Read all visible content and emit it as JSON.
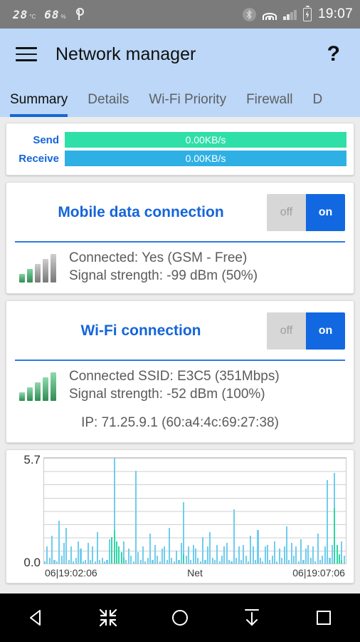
{
  "status_bar": {
    "temperature": "28",
    "temperature_unit": "°C",
    "humidity": "68",
    "humidity_unit": "%",
    "usb_icon": "usb-icon",
    "bluetooth_icon": "bluetooth-icon",
    "bluetooth_glyph": "B",
    "wifi_icon": "wifi-icon",
    "cell_signal_icon": "cell-signal-icon",
    "battery_icon": "battery-charging-icon",
    "battery_glyph": "⚡",
    "time": "19:07"
  },
  "app_bar": {
    "menu_icon": "hamburger-menu-icon",
    "title": "Network manager",
    "help_icon": "?",
    "tabs": [
      {
        "label": "Summary",
        "active": true
      },
      {
        "label": "Details",
        "active": false
      },
      {
        "label": "Wi-Fi Priority",
        "active": false
      },
      {
        "label": "Firewall",
        "active": false
      },
      {
        "label": "D",
        "active": false
      }
    ]
  },
  "speed_card": {
    "send_label": "Send",
    "send_value": "0.00KB/s",
    "send_color": "#2fdfa8",
    "receive_label": "Receive",
    "receive_value": "0.00KB/s",
    "receive_color": "#2fb0e4"
  },
  "mobile_card": {
    "title": "Mobile data connection",
    "toggle_off_label": "off",
    "toggle_on_label": "on",
    "toggle_state": "on",
    "signal_icon": "cell-signal-bars-icon",
    "signal_bars_filled": 2,
    "signal_bars_total": 5,
    "line1": "Connected: Yes (GSM - Free)",
    "line2": "Signal strength: -99 dBm (50%)"
  },
  "wifi_card": {
    "title": "Wi-Fi connection",
    "toggle_off_label": "off",
    "toggle_on_label": "on",
    "toggle_state": "on",
    "signal_icon": "wifi-signal-bars-icon",
    "signal_bars_filled": 5,
    "signal_bars_total": 5,
    "line1": "Connected SSID: E3C5 (351Mbps)",
    "line2": "Signal strength: -52 dBm (100%)",
    "ip_line": "IP: 71.25.9.1 (60:a4:4c:69:27:38)"
  },
  "chart_data": {
    "type": "area",
    "title": "",
    "xlabel": "Net",
    "ylabel": "",
    "ylim": [
      0.0,
      5.7
    ],
    "y_ticks": [
      "0.0",
      "5.7"
    ],
    "x_tick_left": "06|19:02:06",
    "x_tick_center": "Net",
    "x_tick_right": "06|19:07:06",
    "grid": true,
    "legend": "none",
    "series": [
      {
        "name": "Receive",
        "color": "#6fcdee",
        "values": [
          0.1,
          0.9,
          0.3,
          1.5,
          0.2,
          0.1,
          2.3,
          0.4,
          1.1,
          1.9,
          0.2,
          0.9,
          0.1,
          0.3,
          1.2,
          0.8,
          0.1,
          0.2,
          1.1,
          0.2,
          0.9,
          0.1,
          1.7,
          0.2,
          0.3,
          0.1,
          0.2,
          1.3,
          0.4,
          5.7,
          1.0,
          0.9,
          0.3,
          1.2,
          0.2,
          0.8,
          0.4,
          0.1,
          5.0,
          0.6,
          0.2,
          0.9,
          0.1,
          0.3,
          1.6,
          0.2,
          1.0,
          0.4,
          0.1,
          0.8,
          0.9,
          0.2,
          1.9,
          0.3,
          0.1,
          0.7,
          0.2,
          1.1,
          3.3,
          0.4,
          0.9,
          0.2,
          1.0,
          0.8,
          0.3,
          0.1,
          1.4,
          0.2,
          0.9,
          1.7,
          0.3,
          0.2,
          1.0,
          0.1,
          0.4,
          0.9,
          1.1,
          0.2,
          0.1,
          2.9,
          0.3,
          0.9,
          0.2,
          1.0,
          0.4,
          0.1,
          1.5,
          0.9,
          0.2,
          1.8,
          0.3,
          0.1,
          0.9,
          1.0,
          0.2,
          0.4,
          1.2,
          0.1,
          0.8,
          0.3,
          0.9,
          2.0,
          0.2,
          1.1,
          0.4,
          0.9,
          0.1,
          1.3,
          0.2,
          0.8,
          1.0,
          0.3,
          0.9,
          0.1,
          1.6,
          0.2,
          0.4,
          0.9,
          4.5,
          0.3,
          1.0,
          4.9,
          0.8,
          0.2,
          1.2,
          0.4
        ],
        "note": "light blue download spikes"
      },
      {
        "name": "Send",
        "color": "#2fd6a4",
        "values": [
          0,
          0,
          0,
          0,
          0,
          0,
          0,
          0,
          0,
          0,
          0,
          0,
          0,
          0,
          0,
          0,
          0,
          0,
          0,
          0,
          0,
          0,
          0,
          0,
          0,
          0,
          0,
          0,
          1.4,
          1.8,
          1.2,
          0.9,
          0.6,
          0.3,
          0,
          0,
          0,
          0,
          0,
          0,
          0,
          0,
          0,
          0,
          0,
          0,
          0,
          0,
          0,
          0,
          0,
          0,
          0,
          0,
          0,
          0,
          0,
          0,
          0.5,
          0,
          0,
          0,
          0,
          0,
          0,
          0,
          0,
          0,
          0,
          0,
          0,
          0,
          0,
          0,
          0,
          0,
          0,
          0,
          0,
          0,
          0,
          0,
          0,
          0,
          0,
          0,
          0,
          0,
          0,
          0,
          0,
          0,
          0,
          0,
          0,
          0,
          0,
          0,
          0,
          0,
          0,
          0,
          0,
          0,
          0,
          0,
          0,
          0,
          0,
          0,
          0,
          0,
          0,
          0,
          0,
          0,
          0,
          0,
          0,
          0,
          0,
          3.0,
          1.0,
          0.5,
          0.2,
          0
        ],
        "note": "teal upload spikes overlapping"
      }
    ]
  },
  "nav_bar": {
    "back_icon": "back-triangle-icon",
    "collapse_icon": "collapse-arrows-icon",
    "home_icon": "home-circle-icon",
    "download_icon": "download-arrow-icon",
    "recents_icon": "recents-square-icon"
  }
}
